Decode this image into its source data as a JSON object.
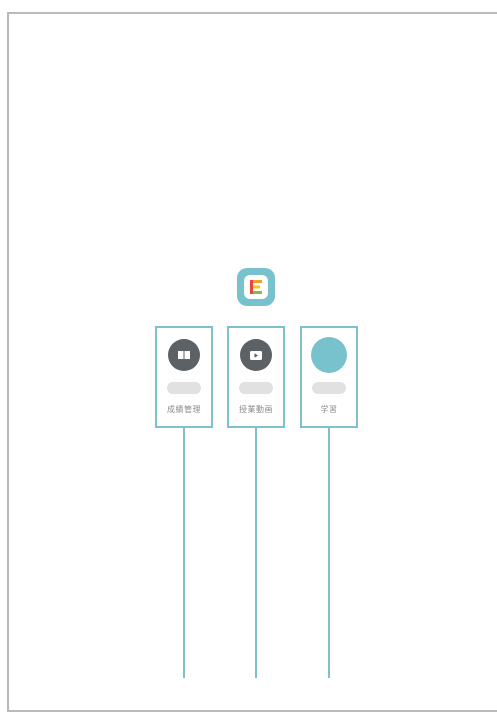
{
  "colors": {
    "accent": "#7ec1cd",
    "dark_icon": "#5c6166",
    "teal_icon": "#78c2cd",
    "placeholder": "#e1e1e1",
    "frame": "#b9b9b9"
  },
  "app_logo": {
    "icon": "app-e-icon"
  },
  "cards": [
    {
      "label": "成績管理",
      "icon": "book-icon"
    },
    {
      "label": "授業動画",
      "icon": "video-icon"
    },
    {
      "label": "学習",
      "icon": "teal-dot-icon"
    }
  ]
}
